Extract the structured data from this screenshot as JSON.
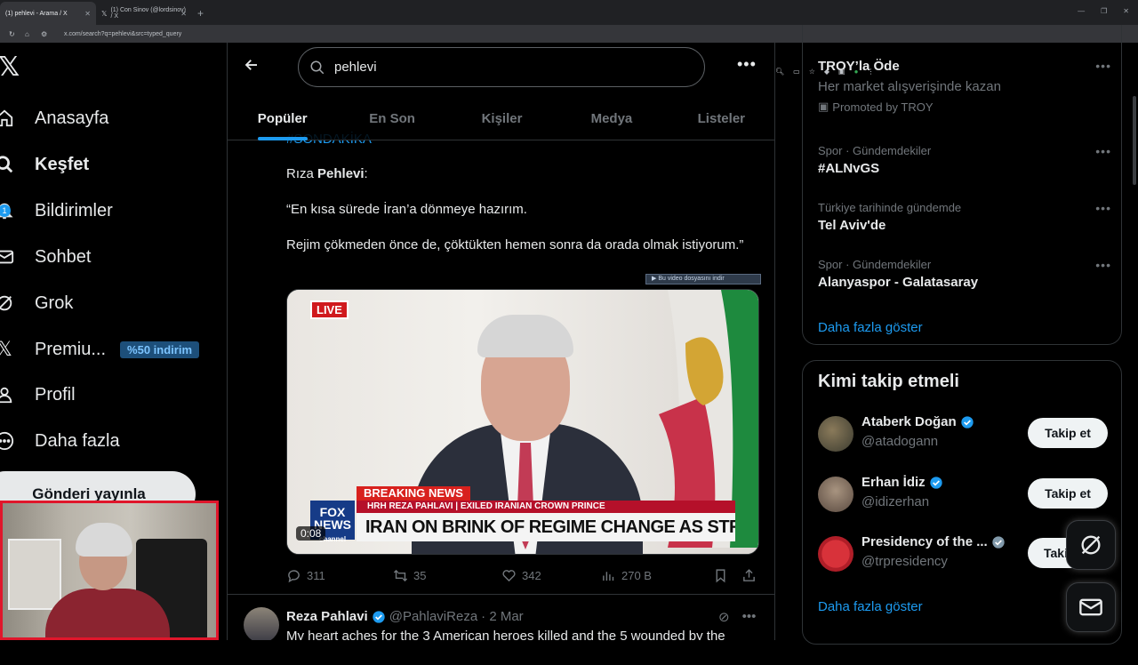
{
  "browser": {
    "tabs": [
      {
        "label": "(1) pehlevi - Arama / X"
      },
      {
        "label": "(1) Con Sinov (@lordsinov) / X"
      }
    ],
    "url": "x.com/search?q=pehlevi&src=typed_query"
  },
  "nav": {
    "items": [
      {
        "label": "Anasayfa",
        "icon": "home-icon"
      },
      {
        "label": "Keşfet",
        "icon": "search-icon"
      },
      {
        "label": "Bildirimler",
        "icon": "bell-icon",
        "badge": "1"
      },
      {
        "label": "Sohbet",
        "icon": "mail-icon"
      },
      {
        "label": "Grok",
        "icon": "grok-icon"
      },
      {
        "label": "Premiu...",
        "icon": "x-icon",
        "promo": "%50 indirim"
      },
      {
        "label": "Profil",
        "icon": "user-icon"
      },
      {
        "label": "Daha fazla",
        "icon": "more-circle-icon"
      }
    ],
    "post_button": "Gönderi yayınla"
  },
  "search": {
    "query": "pehlevi",
    "tabs": [
      "Popüler",
      "En Son",
      "Kişiler",
      "Medya",
      "Listeler"
    ],
    "active_tab": "Popüler"
  },
  "tweet": {
    "hashtag": "#SONDAKİKA",
    "line1_plain": "Rıza ",
    "line1_bold": "Pehlevi",
    "line1_end": ":",
    "para2": "“En kısa sürede İran’a dönmeye hazırım.",
    "para3": "Rejim çökmeden önce de, çöktükten hemen sonra da orada olmak istiyorum.”",
    "video": {
      "live_label": "LIVE",
      "download_label": "Bu video dosyasını indir",
      "breaking": "BREAKING NEWS",
      "subtitle": "HRH REZA PAHLAVI | EXILED IRANIAN CROWN PRINCE",
      "headline": "IRAN ON BRINK OF REGIME CHANGE AS STRIKES HIT",
      "network": "FOX NEWS",
      "network_sub": "channel",
      "timestamp": "0:08"
    },
    "replies": "311",
    "reposts": "35",
    "likes": "342",
    "views": "270 B"
  },
  "tweet2": {
    "name": "Reza Pahlavi",
    "handle": "@PahlaviReza",
    "date": "· 2 Mar",
    "text": "My heart aches for the 3 American heroes killed and the 5 wounded by the"
  },
  "sidebar": {
    "promo": {
      "title": "TROY’la Öde",
      "subtitle": "Her market alışverişinde kazan",
      "promoted": "Promoted by TROY"
    },
    "trends": [
      {
        "meta": "Spor · Gündemdekiler",
        "title": "#ALNvGS"
      },
      {
        "meta": "Türkiye tarihinde gündemde",
        "title": "Tel Aviv'de"
      },
      {
        "meta": "Spor · Gündemdekiler",
        "title": "Alanyaspor - Galatasaray"
      }
    ],
    "show_more": "Daha fazla göster",
    "who_to_follow": {
      "title": "Kimi takip etmeli",
      "follow_label": "Takip et",
      "follow_label_cut": "Taki",
      "accounts": [
        {
          "name": "Ataberk Doğan",
          "handle": "@atadogann"
        },
        {
          "name": "Erhan İdiz",
          "handle": "@idizerhan"
        },
        {
          "name": "Presidency of the ...",
          "handle": "@trpresidency"
        }
      ],
      "show_more": "Daha fazla göster"
    }
  }
}
